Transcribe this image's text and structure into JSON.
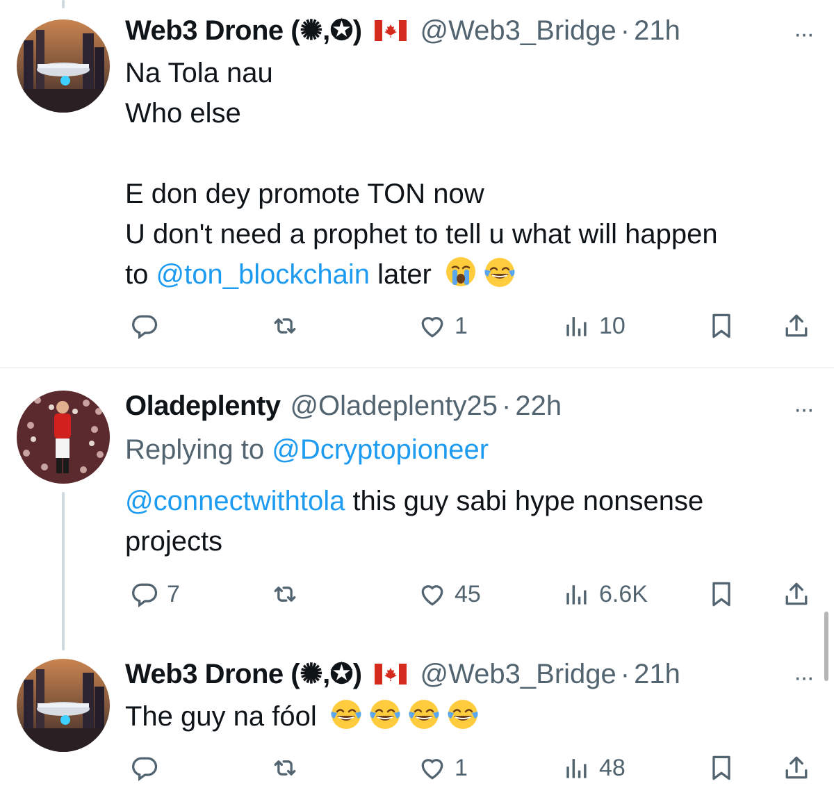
{
  "tweets": [
    {
      "name": "Web3 Drone (✺,✪)",
      "handle": "@Web3_Bridge",
      "sep": "·",
      "time": "21h",
      "more": "···",
      "lines": {
        "l1": "Na Tola nau",
        "l2": "Who else",
        "l3": "E don dey promote TON now",
        "l4": "U don't need a prophet to tell u what will happen",
        "l5_pre": "to ",
        "l5_mention": "@ton_blockchain",
        "l5_post": " later"
      },
      "emojis": [
        "crying-face",
        "tears-of-joy"
      ],
      "counts": {
        "reply": "",
        "repost": "",
        "like": "1",
        "views": "10"
      }
    },
    {
      "name": "Oladeplenty",
      "handle": "@Oladeplenty25",
      "sep": "·",
      "time": "22h",
      "more": "···",
      "replying_label": "Replying to ",
      "replying_to": "@Dcryptopioneer",
      "lines": {
        "l1_mention": "@connectwithtola",
        "l1_post": " this guy sabi hype nonsense",
        "l2": "projects"
      },
      "counts": {
        "reply": "7",
        "repost": "",
        "like": "45",
        "views": "6.6K"
      }
    },
    {
      "name": "Web3 Drone (✺,✪)",
      "handle": "@Web3_Bridge",
      "sep": "·",
      "time": "21h",
      "more": "···",
      "lines": {
        "l1": "The guy na fóol"
      },
      "emojis": [
        "tears-of-joy",
        "tears-of-joy",
        "tears-of-joy",
        "tears-of-joy"
      ],
      "counts": {
        "reply": "",
        "repost": "",
        "like": "1",
        "views": "48"
      }
    }
  ],
  "colors": {
    "text": "#0f1419",
    "secondary": "#536471",
    "mention": "#1d9bf0",
    "thread_line": "#cfd9de"
  }
}
